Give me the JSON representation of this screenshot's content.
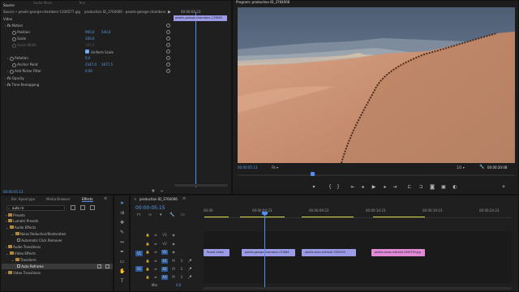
{
  "source_panel": {
    "tabs": [
      "Source",
      "Audio Mixer",
      "Text"
    ],
    "breadcrumb": "Source • pexels-george-chambers-1336577.jpg",
    "sequence_label": "production ID_3764006 - pexels-george-chambers...",
    "ruler_time": "00:00:04:23",
    "clip_label": "pexels-george-chambers-133665",
    "section_video": "Video",
    "properties": [
      {
        "name": "Motion",
        "kind": "group"
      },
      {
        "name": "Position",
        "v1": "960,0",
        "v2": "540,0"
      },
      {
        "name": "Scale",
        "v1": "100,0"
      },
      {
        "name": "Scale Width",
        "v1": "100,0",
        "disabled": true
      },
      {
        "name": "Uniform Scale",
        "kind": "checkbox"
      },
      {
        "name": "Rotation",
        "v1": "0,0"
      },
      {
        "name": "Anchor Point",
        "v1": "2347,0",
        "v2": "1677,5"
      },
      {
        "name": "Anti-flicker Filter",
        "v1": "0,00"
      },
      {
        "name": "Opacity",
        "kind": "group"
      },
      {
        "name": "Time Remapping",
        "kind": "group"
      }
    ],
    "timecode": "00:00:05:13"
  },
  "program_monitor": {
    "title": "Program: production ID_3764006",
    "timecode": "00:00:05:13",
    "fit": "Fit",
    "resolution": "1/2",
    "duration": "00:00:20:08"
  },
  "effects_panel": {
    "tabs": [
      "Bin: Креатура",
      "Media Browser",
      "Effects"
    ],
    "search_value": "auto re",
    "tree": [
      {
        "label": "Presets",
        "level": 0,
        "type": "folder"
      },
      {
        "label": "Lumetri Presets",
        "level": 0,
        "type": "folder"
      },
      {
        "label": "Audio Effects",
        "level": 0,
        "type": "folder"
      },
      {
        "label": "Noise Reduction/Restoration",
        "level": 1,
        "type": "folder"
      },
      {
        "label": "Automatic Click Remover",
        "level": 2,
        "type": "effect"
      },
      {
        "label": "Audio Transitions",
        "level": 0,
        "type": "folder"
      },
      {
        "label": "Video Effects",
        "level": 0,
        "type": "folder"
      },
      {
        "label": "Transform",
        "level": 1,
        "type": "folder"
      },
      {
        "label": "Auto Reframe",
        "level": 2,
        "type": "effect",
        "selected": true
      },
      {
        "label": "Video Transitions",
        "level": 0,
        "type": "folder"
      }
    ]
  },
  "timeline": {
    "tab": "production ID_3764006",
    "timecode": "00:00:05:15",
    "ruler_labels": [
      "00:00",
      "00:00:04:23",
      "00:00:09:23",
      "00:00:14:23",
      "00:00:19:23",
      "00:00:24:23"
    ],
    "tracks": [
      "V3",
      "V2",
      "V1",
      "A1",
      "A2",
      "A3"
    ],
    "mix_label": "Mix",
    "mix_value": "0,0",
    "source_patch": [
      "V1",
      "A1"
    ],
    "clips": [
      {
        "label": "Pexels Video"
      },
      {
        "label": "pexels-george-chambers-133665"
      },
      {
        "label": "pexels-tiwer-mitchell-7895353"
      },
      {
        "label": "pexels-lucas-mitchell-1959739.jpg"
      }
    ],
    "colors": {
      "clip_blue": "#9b9be8",
      "clip_pink": "#e08ad8",
      "playhead": "#4f8ef7"
    }
  }
}
